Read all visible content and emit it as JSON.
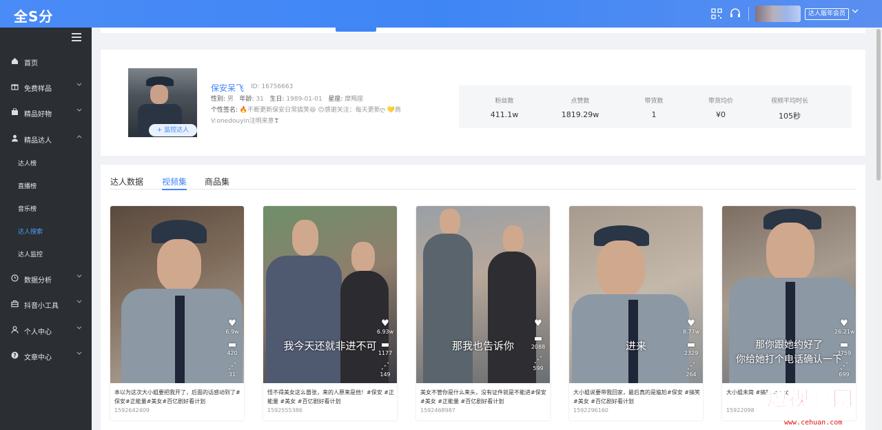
{
  "topbar": {
    "logo": "全S分",
    "vip_label": "达人版年会员"
  },
  "sidebar": {
    "items": [
      {
        "label": "首页",
        "icon": "home-icon",
        "has_arrow": false
      },
      {
        "label": "免费样品",
        "icon": "gift-icon",
        "has_arrow": true
      },
      {
        "label": "精品好物",
        "icon": "bag-icon",
        "has_arrow": true
      },
      {
        "label": "精品达人",
        "icon": "user-icon",
        "has_arrow": true,
        "expanded": true
      },
      {
        "label": "数据分析",
        "icon": "clock-icon",
        "has_arrow": true
      },
      {
        "label": "抖音小工具",
        "icon": "toolbox-icon",
        "has_arrow": true
      },
      {
        "label": "个人中心",
        "icon": "person-icon",
        "has_arrow": true
      },
      {
        "label": "文章中心",
        "icon": "help-icon",
        "has_arrow": true
      }
    ],
    "subitems": [
      {
        "label": "达人榜",
        "active": false
      },
      {
        "label": "直播榜",
        "active": false
      },
      {
        "label": "音乐榜",
        "active": false
      },
      {
        "label": "达人搜索",
        "active": true
      },
      {
        "label": "达人监控",
        "active": false
      }
    ]
  },
  "profile": {
    "name": "保安呆飞",
    "id_label": "ID: 16756663",
    "gender_label": "性别:",
    "gender": "男",
    "age_label": "年龄:",
    "age": "31",
    "birthday_label": "生日:",
    "birthday": "1989-01-01",
    "zodiac_label": "星座:",
    "zodiac": "摩羯座",
    "signature_label": "个性签名:",
    "signature_line1": "🔥不断更新保安日常搞笑😆 😊感谢关注：每天更新ღ 💛商",
    "signature_line2": "V:onedouyin注明来意❣",
    "monitor_button": "+ 监控达人"
  },
  "stats": [
    {
      "label": "粉丝数",
      "value": "411.1w"
    },
    {
      "label": "点赞数",
      "value": "1819.29w"
    },
    {
      "label": "带货数",
      "value": "1"
    },
    {
      "label": "带货均价",
      "value": "¥0"
    },
    {
      "label": "视频平均时长",
      "value": "105秒"
    }
  ],
  "tabs": [
    {
      "label": "达人数据",
      "active": false
    },
    {
      "label": "视频集",
      "active": true
    },
    {
      "label": "商品集",
      "active": false
    }
  ],
  "videos": [
    {
      "overlay": "",
      "likes": "6.9w",
      "comments": "420",
      "shares": "31",
      "caption": "本以为这次大小姐要把我开了，后面的话感动到了#保安#正能量#美女#百亿剧好看计划",
      "id": "1592642409"
    },
    {
      "overlay": "我今天还就非进不可",
      "likes": "6.93w",
      "comments": "1177",
      "shares": "149",
      "caption": "怪不得美女这么嚣张，来的人原来是他！#保安 #正能量 #美女 #百亿剧好看计划",
      "id": "1592555386"
    },
    {
      "overlay": "那我也告诉你",
      "likes": "",
      "comments": "2088",
      "shares": "599",
      "caption": "美女不管你是什么来头，没有证件就是不能进#保安#美女 #正能量 #百亿剧好看计划",
      "id": "1592468987"
    },
    {
      "overlay": "进来",
      "likes": "8.77w",
      "comments": "2329",
      "shares": "264",
      "caption": "大小姐说要带我回家，最后真的是尴尬#保安 #搞笑 #美女 #百亿剧好看计划",
      "id": "1592296160"
    },
    {
      "overlay_line1": "那你跟她约好了",
      "overlay_line2": "你给她打个电话确认一下",
      "likes": "26.21w",
      "comments": "3759",
      "shares": "699",
      "caption": "大小姐未简 #搞笑 #美女",
      "id": "15922098"
    }
  ],
  "watermark": {
    "text": "短视频网",
    "url": "www.cehuan.com"
  },
  "colors": {
    "accent": "#3f86f5",
    "sidebar_bg": "#2b2e33",
    "watermark": "#e8101a"
  }
}
